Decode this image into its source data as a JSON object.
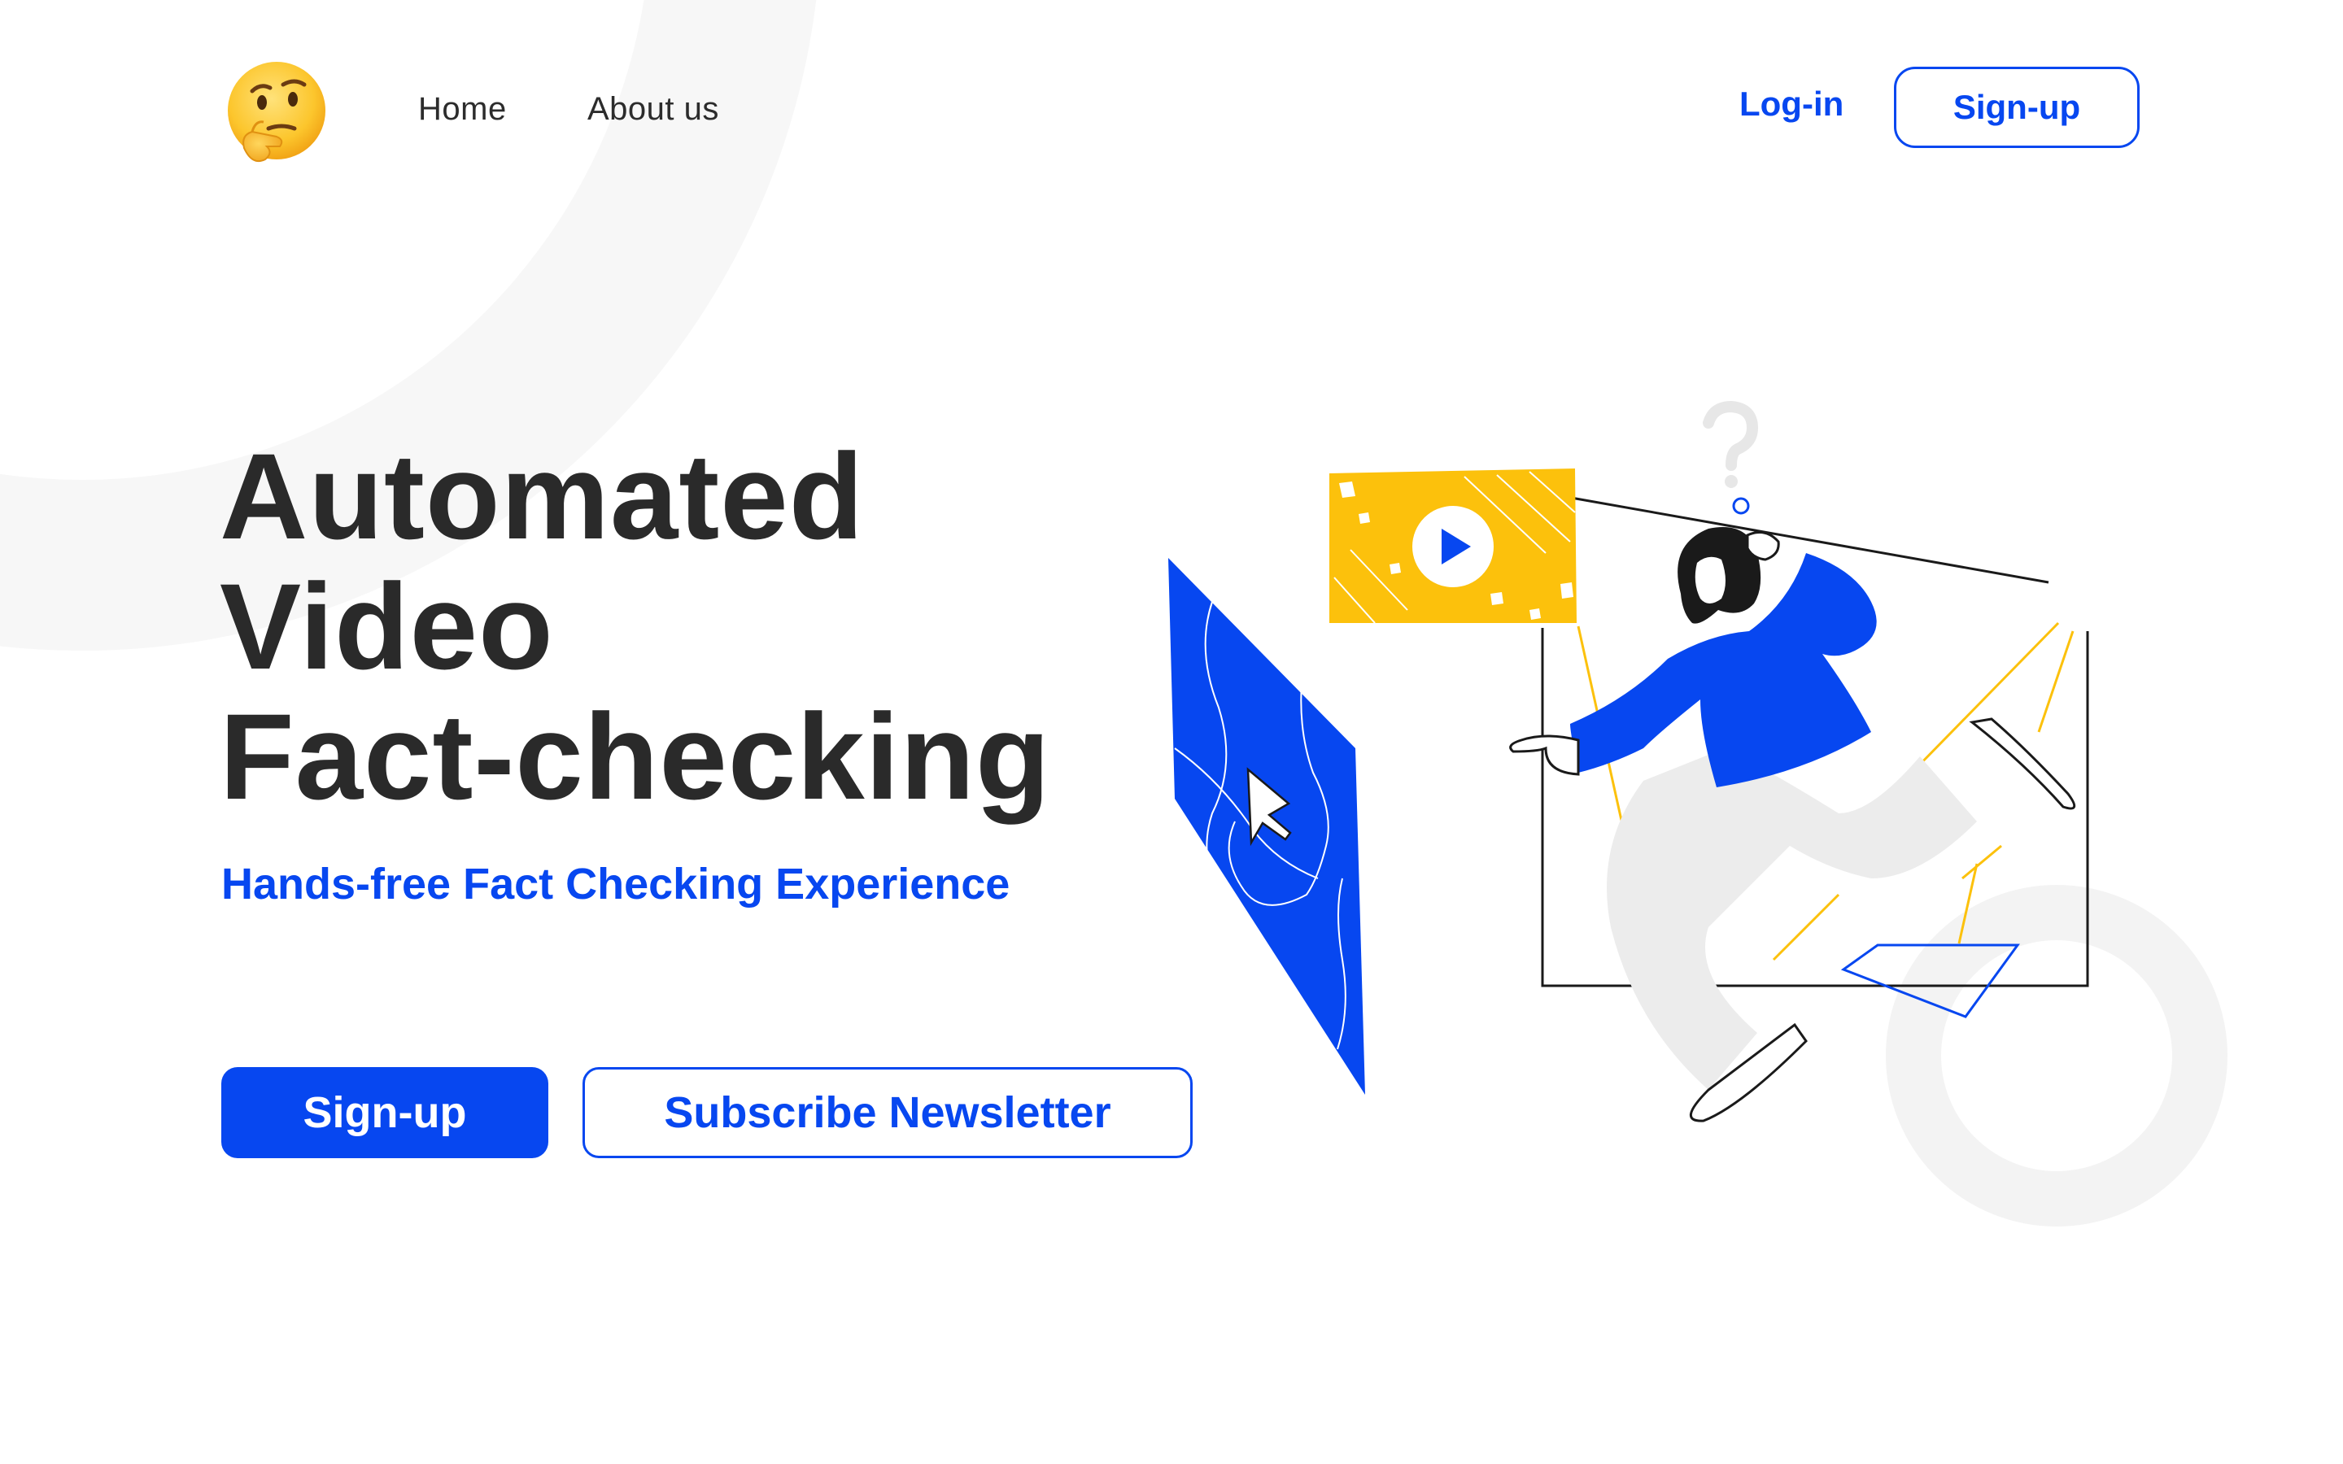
{
  "header": {
    "logo_icon": "thinking-face-emoji",
    "nav": {
      "home": "Home",
      "about": "About us"
    },
    "login_label": "Log-in",
    "signup_label": "Sign-up"
  },
  "hero": {
    "title_lines": [
      "Automated",
      "Video",
      "Fact-checking"
    ],
    "subtitle": "Hands-free Fact Checking Experience",
    "primary_cta": "Sign-up",
    "secondary_cta": "Subscribe Newsletter"
  },
  "illustration": {
    "description_icons": [
      "video-player-icon",
      "play-icon",
      "map-panel-icon",
      "cursor-arrow-icon",
      "question-mark-icon"
    ]
  },
  "colors": {
    "brand_blue": "#0747f0",
    "accent_yellow": "#fcc10c",
    "text_dark": "#2a2a2a",
    "light_gray": "#ececec"
  }
}
